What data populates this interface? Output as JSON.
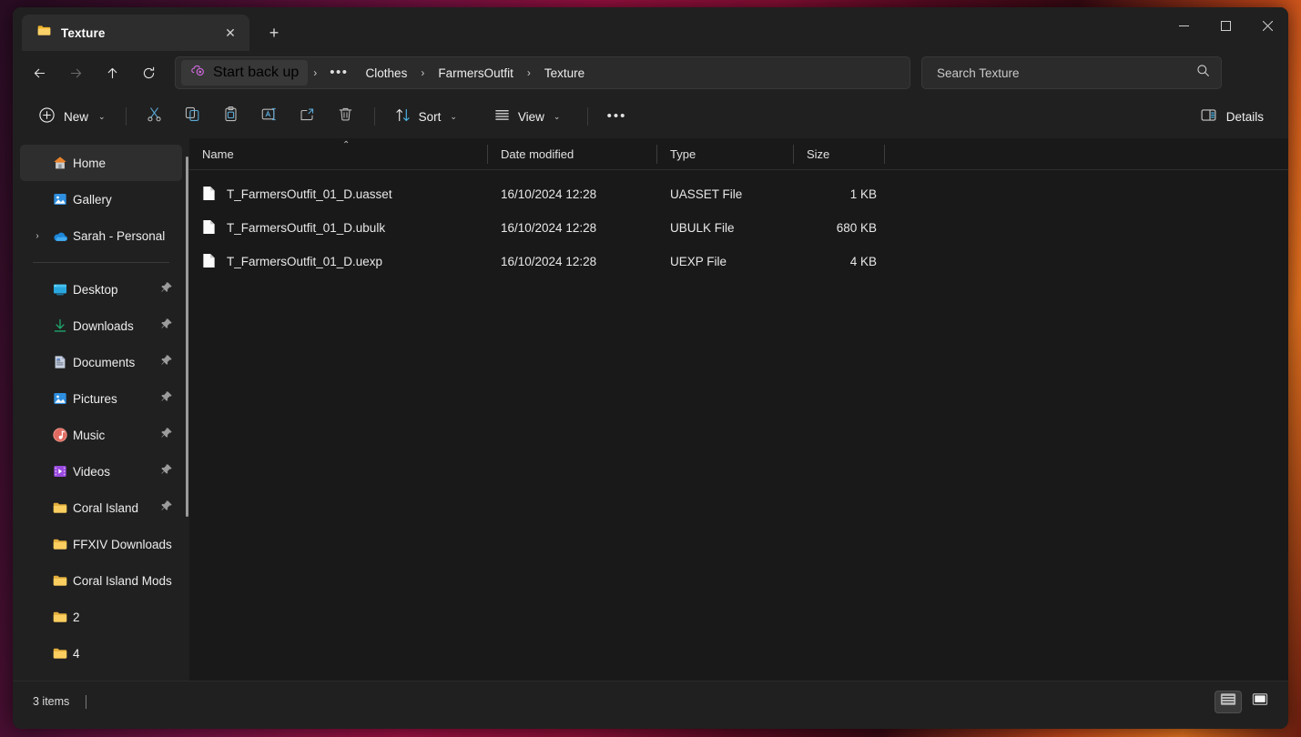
{
  "window": {
    "tab_title": "Texture",
    "tab_icon": "folder-icon",
    "close_tab_label": "✕",
    "new_tab_label": "+",
    "minimize_label": "—",
    "maximize_label": "□",
    "close_label": "✕"
  },
  "nav": {
    "back_label": "←",
    "forward_label": "→",
    "up_label": "↑",
    "refresh_label": "↻"
  },
  "breadcrumb": {
    "backup_label": "Start back up",
    "backup_icon": "onedrive-backup-icon",
    "sep": "›",
    "ellipsis": "•••",
    "items": [
      "Clothes",
      "FarmersOutfit",
      "Texture"
    ]
  },
  "search": {
    "placeholder": "Search Texture",
    "value": "",
    "icon": "search-icon"
  },
  "toolbar": {
    "new_label": "New",
    "new_icon": "plus-circle-icon",
    "cut_icon": "scissors-icon",
    "copy_icon": "copy-icon",
    "paste_icon": "paste-icon",
    "rename_icon": "rename-icon",
    "share_icon": "share-icon",
    "delete_icon": "trash-icon",
    "sort_label": "Sort",
    "sort_icon": "sort-arrows-icon",
    "view_label": "View",
    "view_icon": "list-lines-icon",
    "more_label": "•••",
    "details_label": "Details",
    "details_icon": "details-pane-icon",
    "chevron": "⌄"
  },
  "sidebar": {
    "top_items": [
      {
        "label": "Home",
        "icon": "home-icon",
        "selected": true,
        "expander": false,
        "pinned": false
      },
      {
        "label": "Gallery",
        "icon": "gallery-icon",
        "selected": false,
        "expander": false,
        "pinned": false
      },
      {
        "label": "Sarah - Personal",
        "icon": "onedrive-cloud-icon",
        "selected": false,
        "expander": true,
        "pinned": false
      }
    ],
    "pinned_items": [
      {
        "label": "Desktop",
        "icon": "desktop-icon",
        "pinned": true
      },
      {
        "label": "Downloads",
        "icon": "downloads-icon",
        "pinned": true
      },
      {
        "label": "Documents",
        "icon": "documents-icon",
        "pinned": true
      },
      {
        "label": "Pictures",
        "icon": "pictures-icon",
        "pinned": true
      },
      {
        "label": "Music",
        "icon": "music-icon",
        "pinned": true
      },
      {
        "label": "Videos",
        "icon": "videos-icon",
        "pinned": true
      },
      {
        "label": "Coral Island",
        "icon": "folder-icon",
        "pinned": true
      },
      {
        "label": "FFXIV Downloads",
        "icon": "folder-icon",
        "pinned": false
      },
      {
        "label": "Coral Island Mods",
        "icon": "folder-icon",
        "pinned": false
      },
      {
        "label": "2",
        "icon": "folder-icon",
        "pinned": false
      },
      {
        "label": "4",
        "icon": "folder-icon",
        "pinned": false
      }
    ],
    "expander_glyph": "›",
    "pin_icon": "pin-icon"
  },
  "filelist": {
    "columns": [
      "Name",
      "Date modified",
      "Type",
      "Size"
    ],
    "sort_indicator": "⌃",
    "rows": [
      {
        "name": "T_FarmersOutfit_01_D.uasset",
        "date": "16/10/2024 12:28",
        "type": "UASSET File",
        "size": "1 KB",
        "icon": "file-icon"
      },
      {
        "name": "T_FarmersOutfit_01_D.ubulk",
        "date": "16/10/2024 12:28",
        "type": "UBULK File",
        "size": "680 KB",
        "icon": "file-icon"
      },
      {
        "name": "T_FarmersOutfit_01_D.uexp",
        "date": "16/10/2024 12:28",
        "type": "UEXP File",
        "size": "4 KB",
        "icon": "file-icon"
      }
    ]
  },
  "status": {
    "item_count": "3 items",
    "details_view_icon": "details-view-icon",
    "tiles_view_icon": "large-icons-view-icon"
  },
  "colors": {
    "window_bg": "#202020",
    "content_bg": "#191919",
    "accent_blue": "#4cc2ff",
    "folder_yellow": "#f5c252",
    "onedrive_purple": "#d36ce0"
  }
}
